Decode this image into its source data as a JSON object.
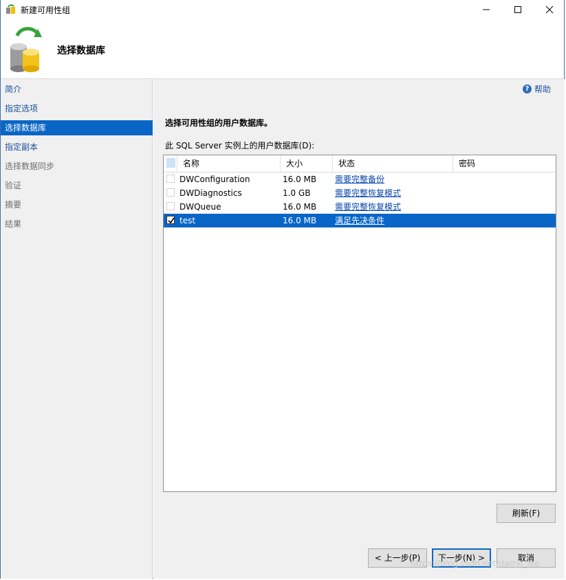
{
  "window": {
    "title": "新建可用性组",
    "header_title": "选择数据库"
  },
  "sidebar": {
    "items": [
      {
        "label": "简介",
        "state": "enabled"
      },
      {
        "label": "指定选项",
        "state": "enabled"
      },
      {
        "label": "选择数据库",
        "state": "selected"
      },
      {
        "label": "指定副本",
        "state": "enabled"
      },
      {
        "label": "选择数据同步",
        "state": "disabled"
      },
      {
        "label": "验证",
        "state": "disabled"
      },
      {
        "label": "摘要",
        "state": "disabled"
      },
      {
        "label": "结果",
        "state": "disabled"
      }
    ]
  },
  "main": {
    "help_label": "帮助",
    "section_title": "选择可用性组的用户数据库。",
    "list_label": "此 SQL Server 实例上的用户数据库(D):",
    "table": {
      "columns": [
        "名称",
        "大小",
        "状态",
        "密码"
      ],
      "rows": [
        {
          "checked": false,
          "name": "DWConfiguration",
          "size": "16.0 MB",
          "status": "需要完整备份",
          "password": ""
        },
        {
          "checked": false,
          "name": "DWDiagnostics",
          "size": "1.0 GB",
          "status": "需要完整恢复模式",
          "password": ""
        },
        {
          "checked": false,
          "name": "DWQueue",
          "size": "16.0 MB",
          "status": "需要完整恢复模式",
          "password": ""
        },
        {
          "checked": true,
          "name": "test",
          "size": "16.0 MB",
          "status": "满足先决条件",
          "password": ""
        }
      ]
    },
    "refresh_label": "刷新(F)"
  },
  "footer": {
    "prev_label": "< 上一步(P)",
    "next_label": "下一步(N) >",
    "cancel_label": "取消"
  },
  "watermark": "https://blog.csdn.net/darryl_lee",
  "colors": {
    "selection": "#0a66c6",
    "link": "#0645ad",
    "panel_bg": "#f0f0f0"
  }
}
